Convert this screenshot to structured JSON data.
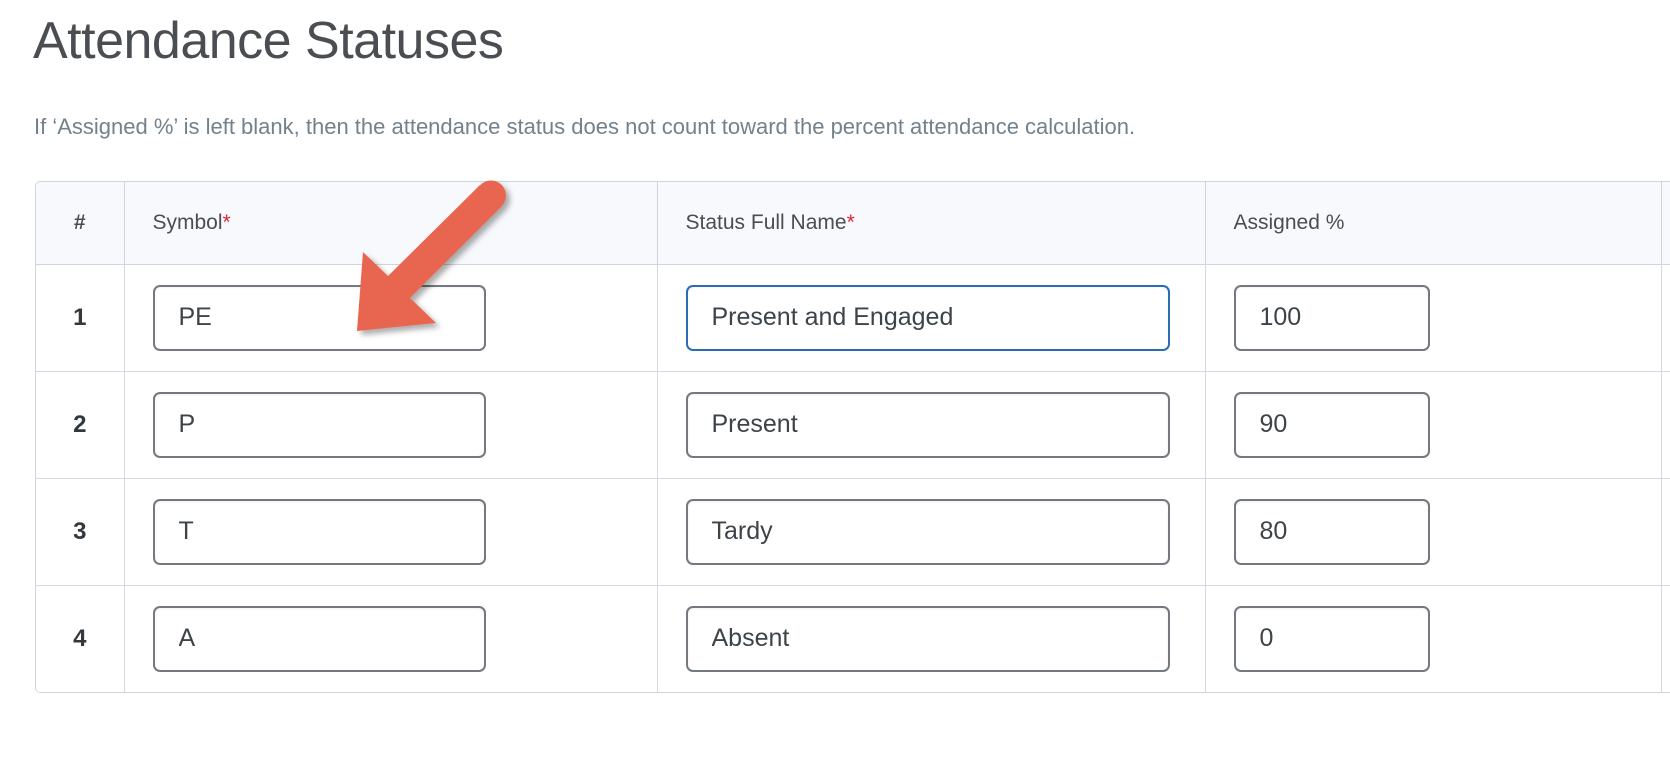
{
  "page": {
    "title": "Attendance Statuses",
    "subtitle": "If ‘Assigned %’ is left blank, then the attendance status does not count toward the percent attendance calculation."
  },
  "table": {
    "columns": {
      "number": "#",
      "symbol": "Symbol",
      "symbol_required_marker": "*",
      "status_full_name": "Status Full Name",
      "status_full_name_required_marker": "*",
      "assigned_percent": "Assigned %"
    },
    "rows": [
      {
        "number": "1",
        "symbol": "PE",
        "symbol_placeholder": "",
        "status_full_name": "Present and Engaged",
        "status_full_name_placeholder": "",
        "assigned_percent": "100",
        "assigned_percent_placeholder": "",
        "focused_field": "status_full_name"
      },
      {
        "number": "2",
        "symbol": "P",
        "symbol_placeholder": "",
        "status_full_name": "Present",
        "status_full_name_placeholder": "",
        "assigned_percent": "90",
        "assigned_percent_placeholder": "",
        "focused_field": ""
      },
      {
        "number": "3",
        "symbol": "T",
        "symbol_placeholder": "",
        "status_full_name": "Tardy",
        "status_full_name_placeholder": "",
        "assigned_percent": "80",
        "assigned_percent_placeholder": "",
        "focused_field": ""
      },
      {
        "number": "4",
        "symbol": "A",
        "symbol_placeholder": "",
        "status_full_name": "Absent",
        "status_full_name_placeholder": "",
        "assigned_percent": "0",
        "assigned_percent_placeholder": "",
        "focused_field": ""
      }
    ]
  },
  "annotation": {
    "arrow": {
      "icon": "arrow-pointer-down-left-icon",
      "color": "#e8664f",
      "points_at": "row-1-symbol-input"
    }
  },
  "colors": {
    "required_star": "#e0252b",
    "focus_border": "#2b6cb5",
    "input_border": "#73797f",
    "table_border": "#cdd5dd",
    "header_background": "#f7f9fc",
    "title_text": "#4a4e52",
    "subtitle_text": "#73818c",
    "annotation_arrow": "#e8664f"
  }
}
